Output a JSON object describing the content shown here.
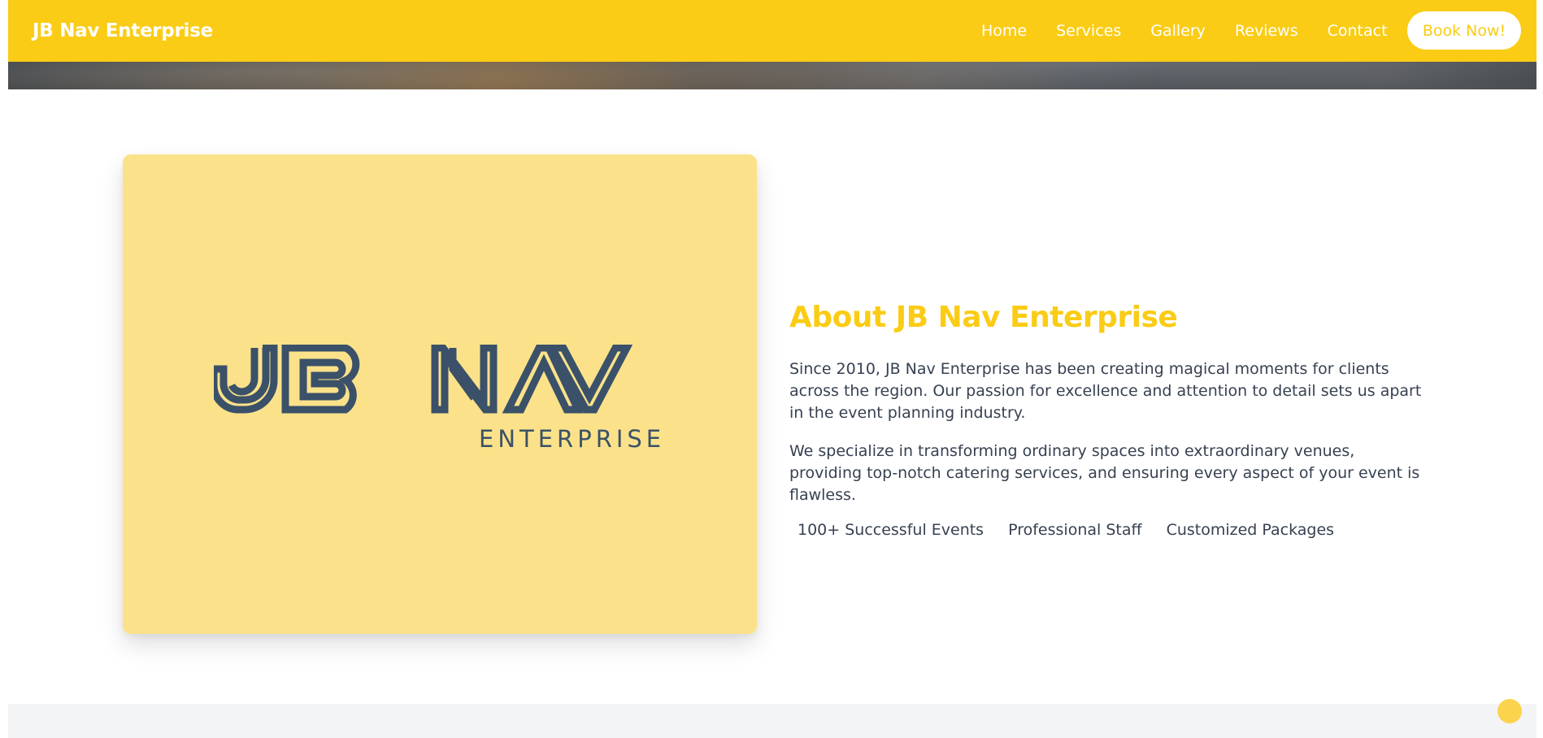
{
  "navbar": {
    "brand": "JB Nav Enterprise",
    "links": [
      "Home",
      "Services",
      "Gallery",
      "Reviews",
      "Contact"
    ],
    "book_label": "Book Now!"
  },
  "about": {
    "logo_text_main": "JB NAV",
    "logo_text_sub": "ENTERPRISE",
    "title": "About JB Nav Enterprise",
    "paragraphs": [
      "Since 2010, JB Nav Enterprise has been creating magical moments for clients across the region. Our passion for excellence and attention to detail sets us apart in the event planning industry.",
      "We specialize in transforming ordinary spaces into extraordinary venues, providing top-notch catering services, and ensuring every aspect of your event is flawless."
    ],
    "features": [
      "100+ Successful Events",
      "Professional Staff",
      "Customized Packages"
    ]
  },
  "colors": {
    "accent": "#facc15",
    "card_bg": "#fbe28a",
    "logo": "#3b5169",
    "text": "#374151"
  },
  "icons": {
    "scroll": "scroll-to-top-dot"
  }
}
